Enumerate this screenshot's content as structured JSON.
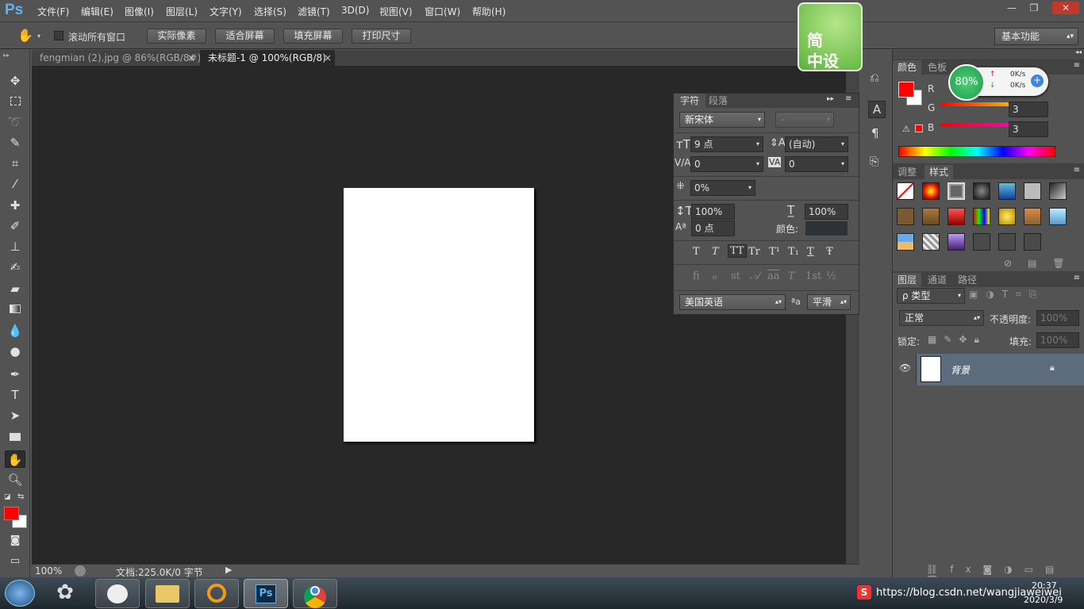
{
  "app": {
    "logo": "Ps"
  },
  "menu": [
    "文件(F)",
    "编辑(E)",
    "图像(I)",
    "图层(L)",
    "文字(Y)",
    "选择(S)",
    "滤镜(T)",
    "3D(D)",
    "视图(V)",
    "窗口(W)",
    "帮助(H)"
  ],
  "window_controls": {
    "minimize": "—",
    "restore": "❐",
    "close": "✕"
  },
  "options": {
    "scroll_all_label": "滚动所有窗口",
    "actual_pixels": "实际像素",
    "fit_screen": "适合屏幕",
    "fill_screen": "填充屏幕",
    "print_size": "打印尺寸",
    "workspace": "基本功能"
  },
  "tabs": [
    {
      "label": "fengmian (2).jpg @ 86%(RGB/8#)",
      "close": "×"
    },
    {
      "label": "未标题-1 @ 100%(RGB/8)",
      "close": "×"
    }
  ],
  "status": {
    "zoom": "100%",
    "doc": "文档:225.0K/0 字节"
  },
  "watermark": {
    "line1": "简",
    "line2": "中设"
  },
  "net_widget": {
    "percent": "80%",
    "up": "0K/s",
    "down": "0K/s"
  },
  "character": {
    "tab1": "字符",
    "tab2": "段落",
    "font": "新宋体",
    "style": "-",
    "size": "9 点",
    "leading": "(自动)",
    "kerning": "0",
    "tracking": "0",
    "scale_pct": "0%",
    "vscale": "100%",
    "hscale": "100%",
    "baseline": "0 点",
    "color_label": "颜色:",
    "type_buttons": [
      "T",
      "T",
      "TT",
      "Tr",
      "T¹",
      "T₁",
      "T",
      "Ŧ"
    ],
    "opentype_buttons": [
      "fi",
      "ℴ",
      "st",
      "𝒜",
      "aa",
      "T",
      "1st",
      "½"
    ],
    "language": "美国英语",
    "aa_label": "ªa",
    "aa_mode": "平滑"
  },
  "color_panel": {
    "tab1": "颜色",
    "tab2": "色板",
    "r_label": "R",
    "g_label": "G",
    "b_label": "B",
    "g_value": "3",
    "b_value": "3"
  },
  "styles_panel": {
    "tab1": "调整",
    "tab2": "样式"
  },
  "layers_panel": {
    "tab1": "图层",
    "tab2": "通道",
    "tab3": "路径",
    "filter": "ρ 类型",
    "blend": "正常",
    "opacity_label": "不透明度:",
    "opacity": "100%",
    "lock_label": "锁定:",
    "fill_label": "填充:",
    "fill": "100%",
    "layer_name": "背景"
  },
  "taskbar": {
    "tray_text": "https://blog.csdn.net/wangjiaweiwei",
    "time": "20:37",
    "date": "2020/3/9",
    "tray_s": "S"
  },
  "colors": {
    "accent": "#3e83c5",
    "foreground": "#ff0000",
    "background": "#ffffff"
  }
}
